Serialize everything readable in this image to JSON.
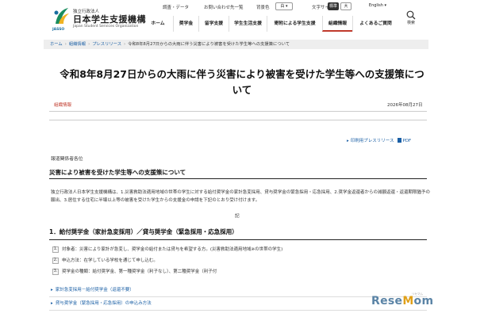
{
  "header": {
    "logo": {
      "org_type": "独立行政法人",
      "name": "日本学生支援機構",
      "name_en": "Japan Student Services Organization",
      "abbr": "JASSO"
    },
    "utility": {
      "research": "調査・データ",
      "contact": "お問い合わせ先一覧",
      "bg_color_label": "背景色",
      "bg_color_value": "白",
      "text_size_label": "文字サイズ",
      "text_size_standard": "標準",
      "text_size_large": "大",
      "language": "English"
    },
    "nav": [
      "ホーム",
      "奨学金",
      "留学支援",
      "学生生活支援",
      "寄附による学生支援",
      "組織情報",
      "よくあるご質問"
    ],
    "search_label": "検索"
  },
  "breadcrumb": {
    "items": [
      "ホーム",
      "組織情報",
      "プレスリリース",
      "令和8年8月27日からの大雨に伴う災害により被害を受けた学生等への支援策について"
    ]
  },
  "article": {
    "title": "令和8年8月27日からの大雨に伴う災害により被害を受けた学生等への支援策について",
    "category": "組織情報",
    "date": "2026年08月27日",
    "print_link": "印刷用プレスリリース",
    "pdf_label": "PDF",
    "addressee": "報道関係者各位",
    "section1_heading": "災害により被害を受けた学生等への支援策について",
    "body": "独立行政法人日本学生支援機構は、1.災害救助法適用地域の世帯の学生に対する給付奨学金の家計急変採用、貸与奨学金の緊急採用・応急採用、2.奨学金返還者からの減額返還・返還期限猶予の願出、3.居住する住宅に半壊以上等の被害を受けた学生からの支援金の申請を下記のとおり受け付けます。",
    "ki": "記",
    "section2_heading": "1．給付奨学金（家計急変採用）／貸与奨学金（緊急採用・応急採用）",
    "list": [
      {
        "num": "1.",
        "text": "対象者：災害により家計が急変し、奨学金の給付または貸与を希望する方。(災害救助法適用地域※の世帯の学生)"
      },
      {
        "num": "2.",
        "text": "申込方法：在学している学校を通じて申し込む。"
      },
      {
        "num": "3.",
        "text": "奨学金の種類：給付奨学金、第一種奨学金（利子なし）、第二種奨学金（利子付"
      }
    ],
    "links": [
      "家計急変採用－給付奨学金（返還不要）",
      "貸与奨学金（緊急採用・応急採用）の申込み方法"
    ]
  },
  "watermark": {
    "text_a": "Rese",
    "text_o": "M",
    "text_b": "om",
    "sub": "リセマム"
  }
}
